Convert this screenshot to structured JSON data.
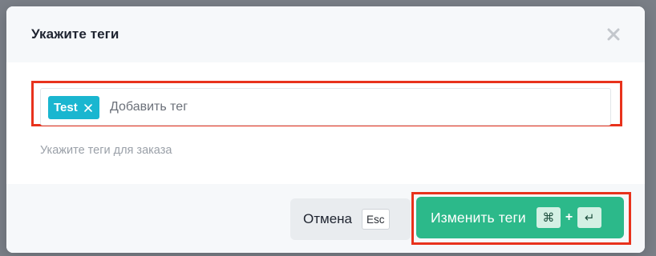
{
  "dialog": {
    "title": "Укажите теги",
    "close_icon": "close-icon"
  },
  "tag_input": {
    "tags": [
      {
        "label": "Test",
        "remove_icon": "close-icon"
      }
    ],
    "placeholder": "Добавить тег",
    "value": ""
  },
  "helper_text": "Укажите теги для заказа",
  "footer": {
    "cancel_label": "Отмена",
    "cancel_shortcut": "Esc",
    "submit_label": "Изменить теги",
    "submit_shortcut": {
      "key1": "⌘",
      "plus": "+",
      "key2": "↵"
    }
  },
  "colors": {
    "tag_chip": "#1ab6d0",
    "submit_button": "#2cb98a",
    "highlight_outline": "#e8321c",
    "header_footer_bg": "#f6f8fa"
  }
}
